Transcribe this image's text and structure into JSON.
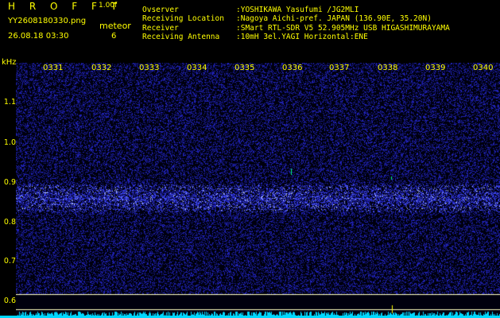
{
  "header": {
    "program_name": "H R O F F T",
    "program_version": "1.00f",
    "filename": "YY2608180330.png",
    "datetime": "26.08.18 03:30",
    "meteor_label": "meteor",
    "meteor_count": "6"
  },
  "station_info": [
    {
      "key": "Ovserver",
      "value": ":YOSHIKAWA Yasufumi /JG2MLI"
    },
    {
      "key": "Receiving Location",
      "value": ":Nagoya Aichi-pref. JAPAN (136.90E, 35.20N)"
    },
    {
      "key": "Receiver",
      "value": ":SMart RTL-SDR V5 52.905MHz USB HIGASHIMURAYAMA"
    },
    {
      "key": "Receiving Antenna",
      "value": ":10mH 3el.YAGI Horizontal:ENE"
    }
  ],
  "spectrogram": {
    "y_unit": "kHz",
    "y_ticks": [
      "1.1",
      "1.0",
      "0.9",
      "0.8",
      "0.7",
      "0.6"
    ],
    "x_ticks": [
      "0331",
      "0332",
      "0333",
      "0334",
      "0335",
      "0336",
      "0337",
      "0338",
      "0339",
      "0340"
    ],
    "colors": {
      "background": "#00000e",
      "noise": "#1f22b5",
      "band": "#4a55ff",
      "hot": "#c0d0ff",
      "axis_text": "#ffff00",
      "level_line": "#ffffc0",
      "level_bars": "#00d8ff",
      "echo": "#00ff80"
    }
  }
}
